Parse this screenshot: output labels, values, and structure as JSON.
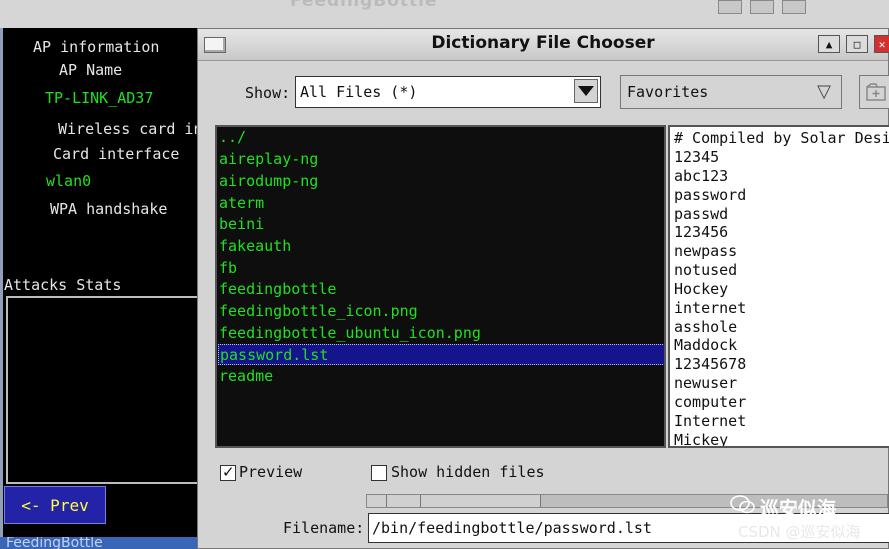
{
  "background_app": {
    "title": "FeedingBottle",
    "labels": {
      "ap_information": "AP information",
      "ap_name": "AP Name",
      "ap_name_value": "TP-LINK_AD37",
      "wireless_card": "Wireless card in",
      "card_interface": "Card interface",
      "card_interface_value": "wlan0",
      "wpa_handshake": "WPA handshake",
      "attacks_stats": "Attacks Stats"
    },
    "prev_button": "<- Prev",
    "bottom_title": "FeedingBottle"
  },
  "dialog": {
    "title": "Dictionary File Chooser",
    "show_label": "Show:",
    "show_value": "All Files (*)",
    "favorites_label": "Favorites",
    "files": [
      {
        "name": "../",
        "selected": false
      },
      {
        "name": "aireplay-ng",
        "selected": false
      },
      {
        "name": "airodump-ng",
        "selected": false
      },
      {
        "name": "aterm",
        "selected": false
      },
      {
        "name": "beini",
        "selected": false
      },
      {
        "name": "fakeauth",
        "selected": false
      },
      {
        "name": "fb",
        "selected": false
      },
      {
        "name": "feedingbottle",
        "selected": false
      },
      {
        "name": "feedingbottle_icon.png",
        "selected": false
      },
      {
        "name": "feedingbottle_ubuntu_icon.png",
        "selected": false
      },
      {
        "name": "password.lst",
        "selected": true
      },
      {
        "name": "readme",
        "selected": false
      }
    ],
    "preview_lines": [
      "# Compiled by Solar Design",
      "12345",
      "abc123",
      "password",
      "passwd",
      "123456",
      "newpass",
      "notused",
      "Hockey",
      "internet",
      "asshole",
      "Maddock",
      "12345678",
      "newuser",
      "computer",
      "Internet",
      "Mickey"
    ],
    "preview_checkbox": {
      "label": "Preview",
      "checked": true
    },
    "hidden_checkbox": {
      "label": "Show hidden files",
      "checked": false
    },
    "filename_label": "Filename:",
    "filename_value": "/bin/feedingbottle/password.lst"
  },
  "watermark": {
    "line1": "巡安似海",
    "line2": "CSDN @巡安似海"
  },
  "colors": {
    "file_text": "#20e020",
    "selection": "#14148c",
    "prev_button_bg": "#2323a8",
    "prev_button_text": "#ffff40"
  }
}
